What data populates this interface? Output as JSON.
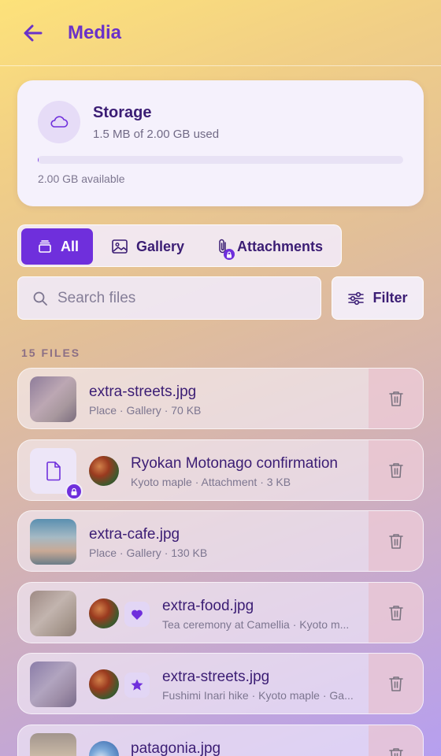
{
  "header": {
    "title": "Media",
    "back_icon": "arrow-left-icon",
    "accent": "#6a31c9"
  },
  "storage": {
    "title": "Storage",
    "used_text": "1.5 MB of 2.00 GB used",
    "available_text": "2.00 GB available",
    "used_fraction": 0.0007,
    "icon": "cloud-icon"
  },
  "tabs": [
    {
      "label": "All",
      "icon": "stack-icon",
      "active": true
    },
    {
      "label": "Gallery",
      "icon": "image-icon",
      "active": false
    },
    {
      "label": "Attachments",
      "icon": "paperclip-lock-icon",
      "active": false
    }
  ],
  "search": {
    "placeholder": "Search files",
    "value": "",
    "icon": "search-icon"
  },
  "filter": {
    "label": "Filter",
    "icon": "sliders-icon"
  },
  "files_count": "15 FILES",
  "files": [
    {
      "name": "extra-streets.jpg",
      "meta": "Place · Gallery · 70 KB"
    },
    {
      "name": "Ryokan Motonago confirmation",
      "meta": "Kyoto maple · Attachment · 3 KB"
    },
    {
      "name": "extra-cafe.jpg",
      "meta": "Place · Gallery · 130 KB"
    },
    {
      "name": "extra-food.jpg",
      "meta": "Tea ceremony at Camellia · Kyoto m...",
      "badge": "heart-icon"
    },
    {
      "name": "extra-streets.jpg",
      "meta": "Fushimi Inari hike · Kyoto maple · Ga...",
      "badge": "star-icon"
    },
    {
      "name": "patagonia.jpg",
      "meta": ""
    }
  ],
  "colors": {
    "primary": "#6f2fdc",
    "text": "#3b1d74",
    "muted": "#7d7690"
  }
}
